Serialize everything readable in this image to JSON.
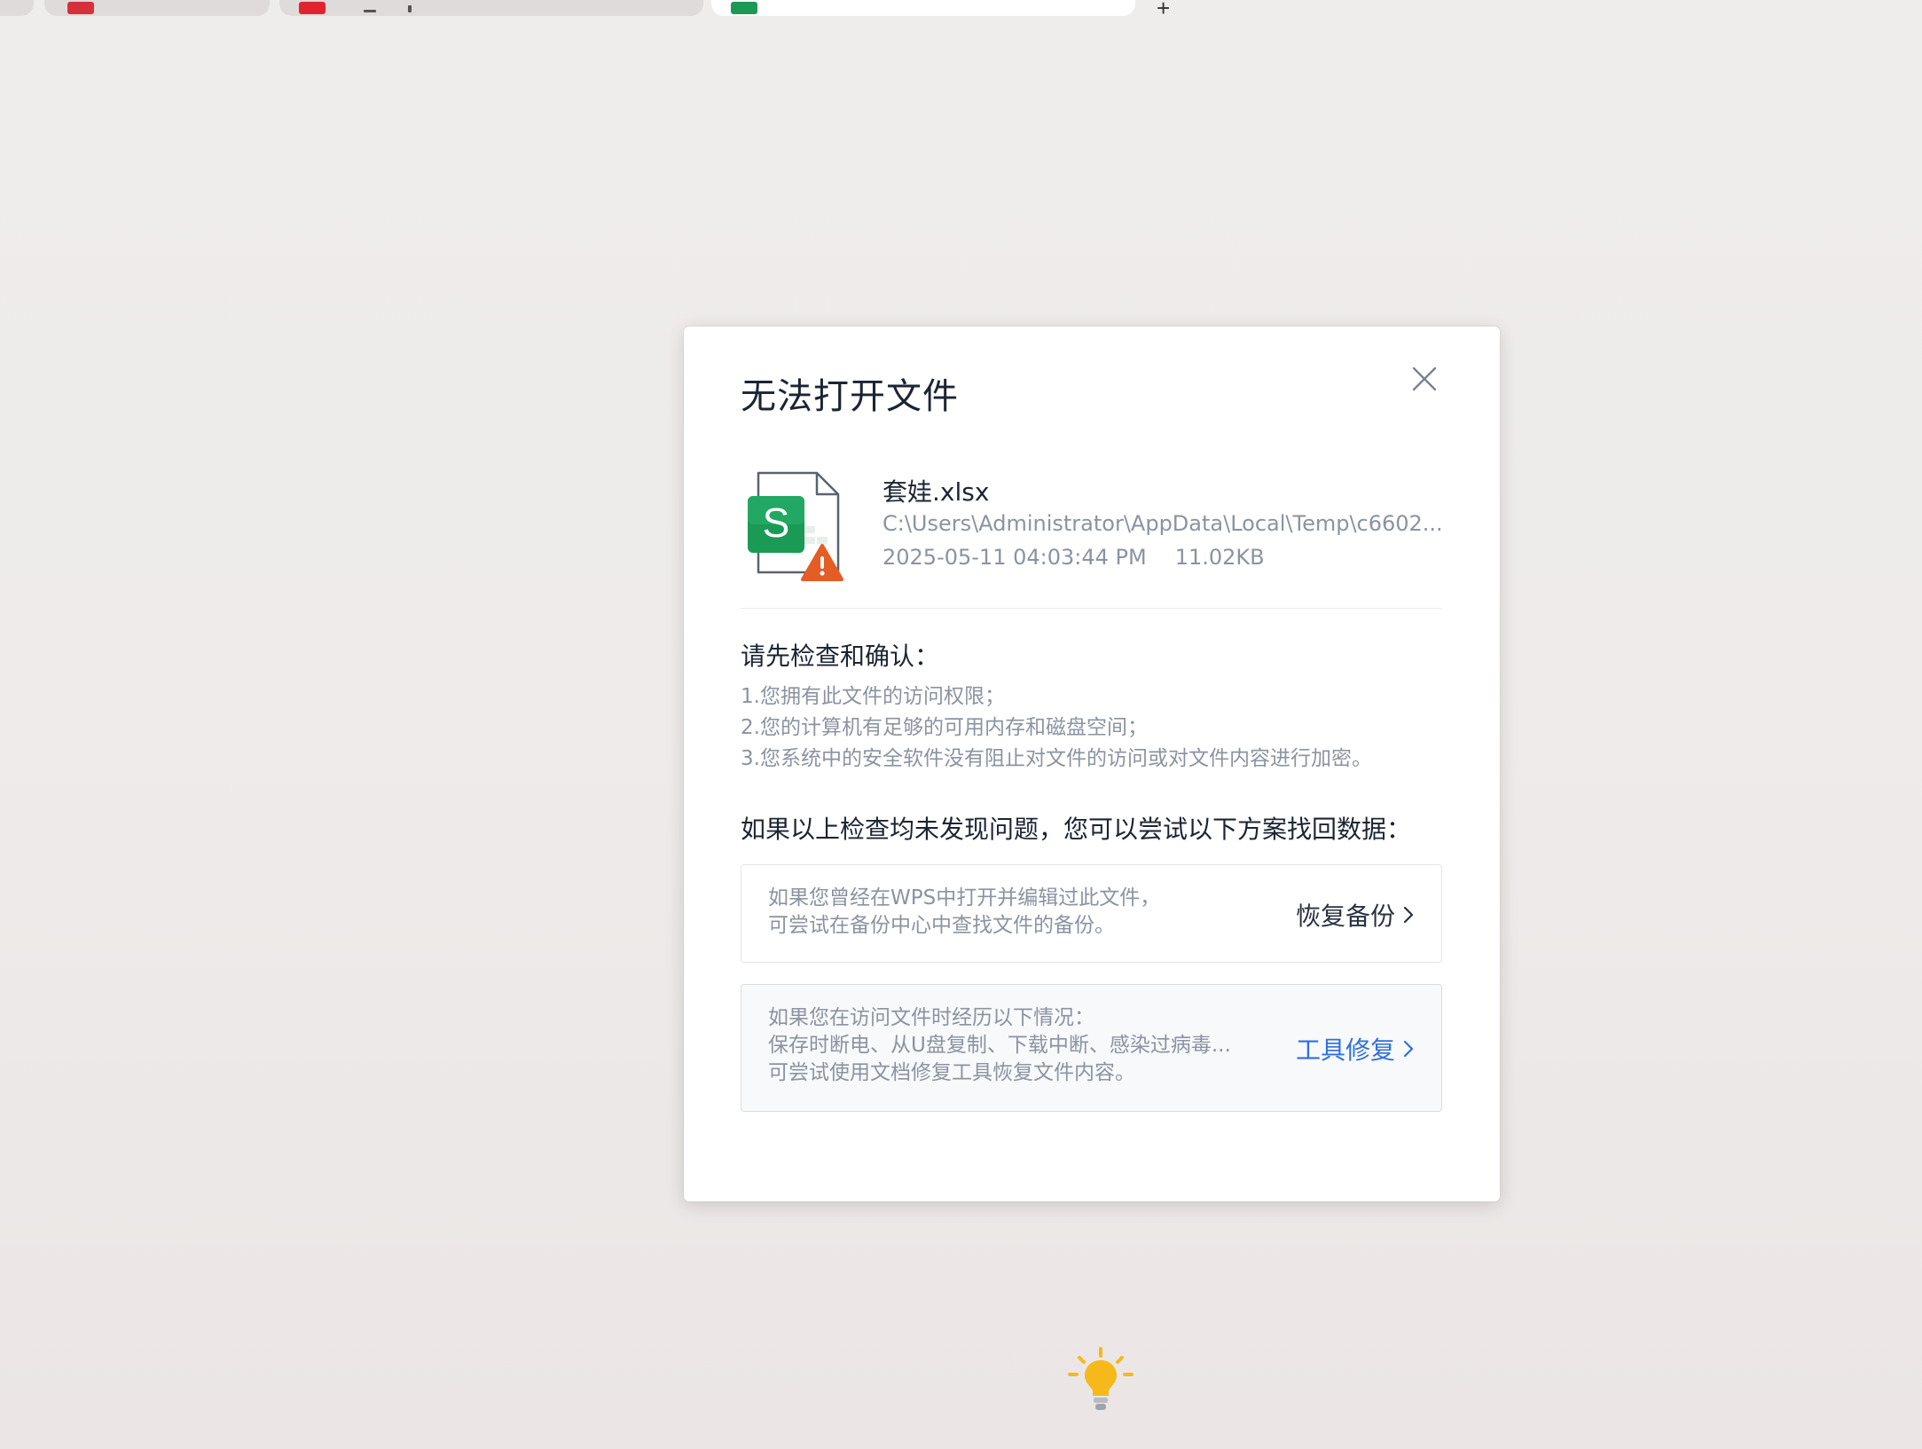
{
  "colors": {
    "accent": "#2f6fde",
    "sheet_green": "#1a9a55",
    "warning_orange": "#e35d25",
    "bulb_yellow": "#f6b91b"
  },
  "dialog": {
    "title": "无法打开文件",
    "close_icon": "close-icon",
    "file": {
      "icon": "spreadsheet-warning-icon",
      "icon_letter": "S",
      "name": "套娃.xlsx",
      "path": "C:\\Users\\Administrator\\AppData\\Local\\Temp\\c6602...",
      "date": "2025-05-11  04:03:44 PM",
      "size": "11.02KB"
    },
    "check": {
      "title": "请先检查和确认：",
      "items": [
        "1.您拥有此文件的访问权限；",
        "2.您的计算机有足够的可用内存和磁盘空间；",
        "3.您系统中的安全软件没有阻止对文件的访问或对文件内容进行加密。"
      ]
    },
    "try_title": "如果以上检查均未发现问题，您可以尝试以下方案找回数据：",
    "options": [
      {
        "lines": [
          "如果您曾经在WPS中打开并编辑过此文件，",
          "可尝试在备份中心中查找文件的备份。"
        ],
        "action": "恢复备份"
      },
      {
        "lines": [
          "如果您在访问文件时经历以下情况：",
          "保存时断电、从U盘复制、下载中断、感染过病毒...",
          "可尝试使用文档修复工具恢复文件内容。"
        ],
        "action": "工具修复"
      }
    ]
  },
  "tip_icon": "lightbulb-icon"
}
